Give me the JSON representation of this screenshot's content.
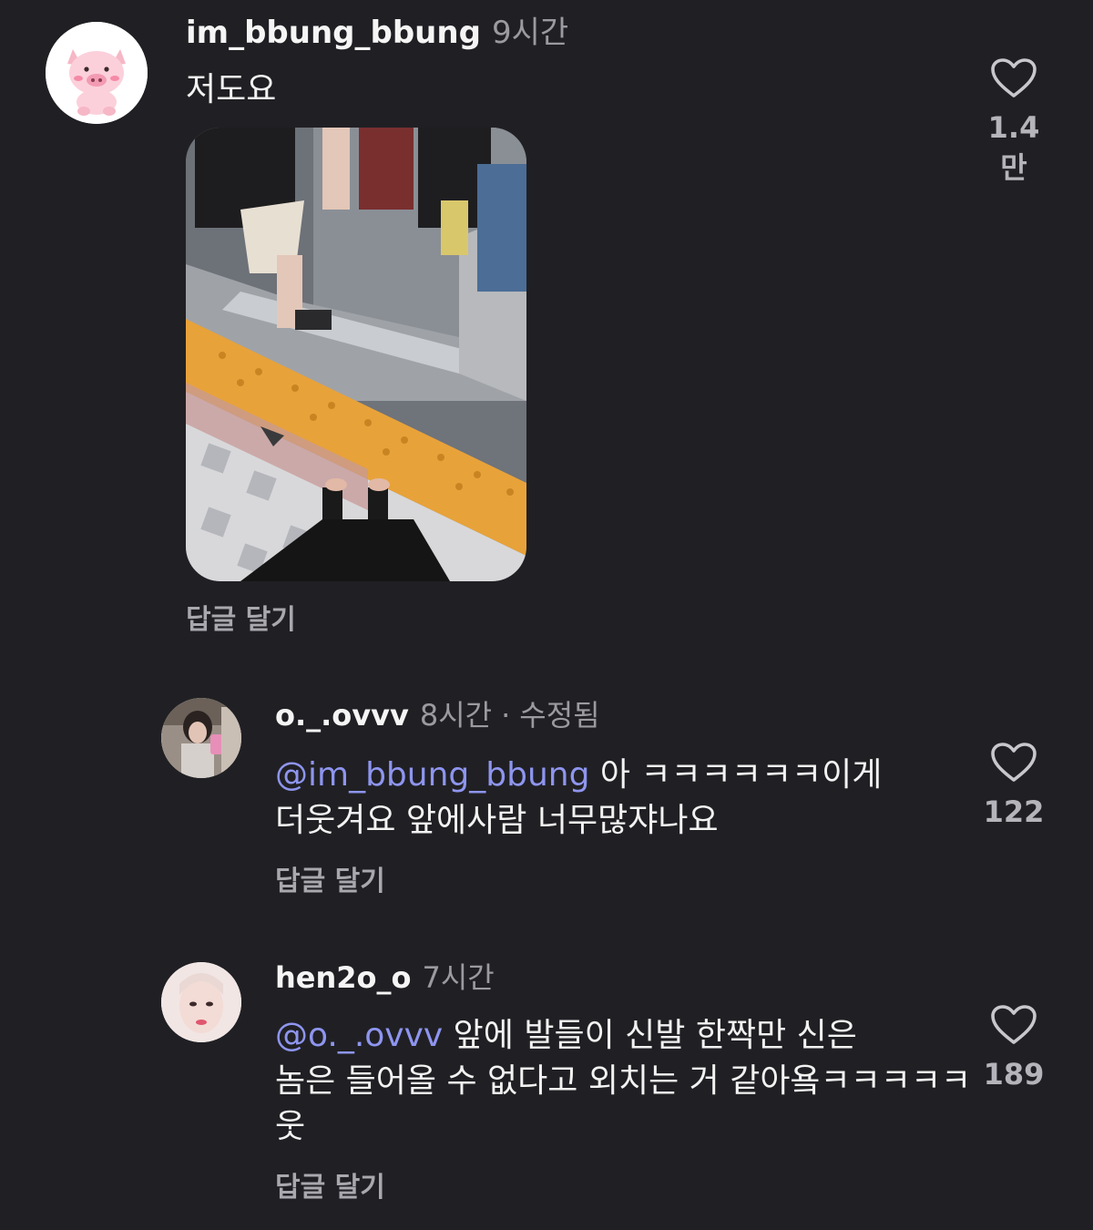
{
  "comments": [
    {
      "username": "im_bbung_bbung",
      "time": "9시간",
      "text": "저도요",
      "reply_label": "답글 달기",
      "likes": "1.4만",
      "avatar_icon": "pig-avatar"
    },
    {
      "username": "o._.ovvv",
      "time": "8시간",
      "edited": "수정됨",
      "mention_icon": "threads-at-icon",
      "mention": "im_bbung_bbung",
      "text_line1": " 아 ㅋㅋㅋㅋㅋㅋ이게",
      "text_line2": "더웃겨요 앞에사람 너무많쟈나요",
      "reply_label": "답글 달기",
      "likes": "122"
    },
    {
      "username": "hen2o_o",
      "time": "7시간",
      "mention_icon": "threads-at-icon",
      "mention": "o._.ovvv",
      "text_line1": " 앞에 발들이 신발 한짝만 신은",
      "text_line2": "놈은 들어올 수 없다고 외치는 거 같아욬ㅋㅋㅋㅋㅋ",
      "text_line3": "웃",
      "reply_label": "답글 달기",
      "likes": "189"
    }
  ],
  "colors": {
    "background": "#202024",
    "mention": "#8e95ef",
    "muted": "#9a9aa0"
  }
}
